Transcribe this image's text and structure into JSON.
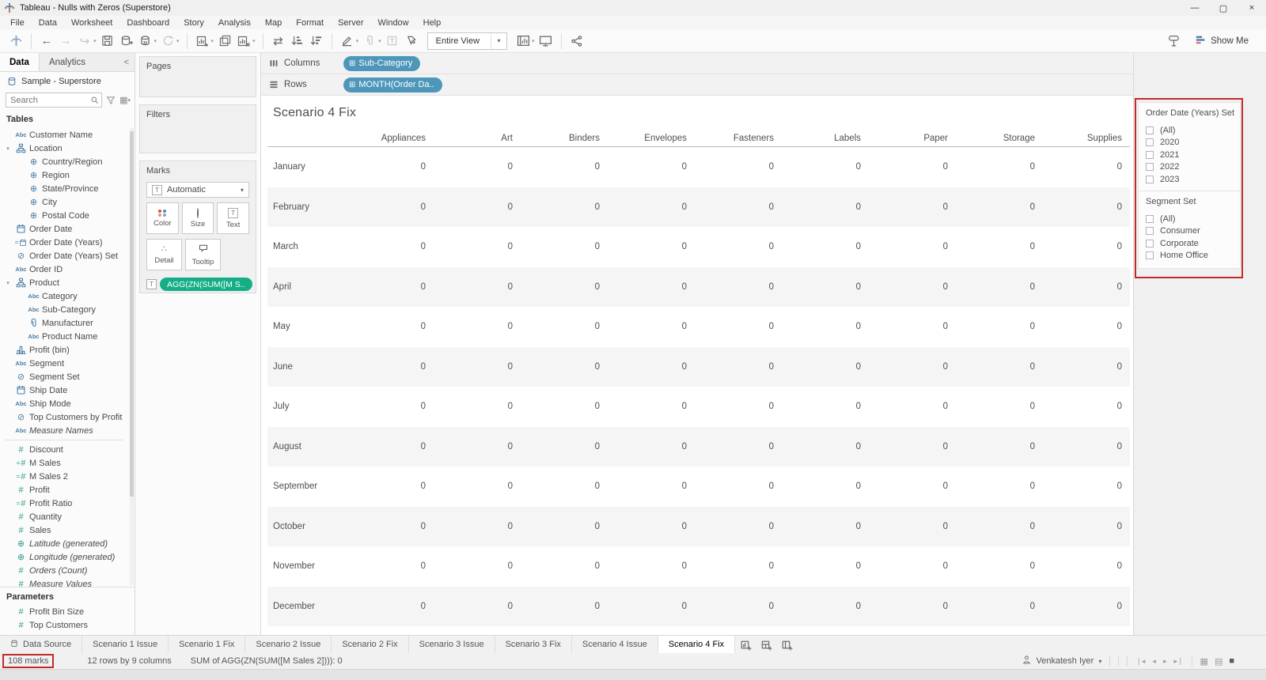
{
  "window": {
    "title": "Tableau - Nulls with Zeros (Superstore)",
    "menu": [
      "File",
      "Data",
      "Worksheet",
      "Dashboard",
      "Story",
      "Analysis",
      "Map",
      "Format",
      "Server",
      "Window",
      "Help"
    ],
    "controls": {
      "minimize": "—",
      "restore": "▢",
      "close": "×"
    }
  },
  "toolbar": {
    "view_mode": "Entire View",
    "show_me_label": "Show Me"
  },
  "sidebar": {
    "tabs": {
      "data": "Data",
      "analytics": "Analytics"
    },
    "datasource": "Sample - Superstore",
    "search_placeholder": "Search",
    "tables_label": "Tables",
    "fields": [
      {
        "icon": "abc",
        "label": "Customer Name",
        "indent": 1
      },
      {
        "icon": "hier",
        "label": "Location",
        "indent": 0,
        "caret": true
      },
      {
        "icon": "globe",
        "label": "Country/Region",
        "indent": 2
      },
      {
        "icon": "globe",
        "label": "Region",
        "indent": 2
      },
      {
        "icon": "globe",
        "label": "State/Province",
        "indent": 2
      },
      {
        "icon": "globe",
        "label": "City",
        "indent": 2
      },
      {
        "icon": "globe",
        "label": "Postal Code",
        "indent": 2
      },
      {
        "icon": "cal",
        "label": "Order Date",
        "indent": 1
      },
      {
        "icon": "cal-calc",
        "label": "Order Date (Years)",
        "indent": 1
      },
      {
        "icon": "set",
        "label": "Order Date (Years) Set",
        "indent": 1
      },
      {
        "icon": "abc",
        "label": "Order ID",
        "indent": 1
      },
      {
        "icon": "hier",
        "label": "Product",
        "indent": 0,
        "caret": true
      },
      {
        "icon": "abc",
        "label": "Category",
        "indent": 2
      },
      {
        "icon": "abc",
        "label": "Sub-Category",
        "indent": 2
      },
      {
        "icon": "clip",
        "label": "Manufacturer",
        "indent": 2
      },
      {
        "icon": "abc",
        "label": "Product Name",
        "indent": 2
      },
      {
        "icon": "bin",
        "label": "Profit (bin)",
        "indent": 1
      },
      {
        "icon": "abc",
        "label": "Segment",
        "indent": 1
      },
      {
        "icon": "set",
        "label": "Segment Set",
        "indent": 1
      },
      {
        "icon": "cal",
        "label": "Ship Date",
        "indent": 1
      },
      {
        "icon": "abc",
        "label": "Ship Mode",
        "indent": 1
      },
      {
        "icon": "set",
        "label": "Top Customers by Profit",
        "indent": 1
      },
      {
        "icon": "abc",
        "label": "Measure Names",
        "indent": 1,
        "italic": true
      },
      {
        "divider": true
      },
      {
        "icon": "hash",
        "label": "Discount",
        "indent": 1
      },
      {
        "icon": "hash-calc",
        "label": "M Sales",
        "indent": 1
      },
      {
        "icon": "hash-calc",
        "label": "M Sales 2",
        "indent": 1
      },
      {
        "icon": "hash",
        "label": "Profit",
        "indent": 1
      },
      {
        "icon": "hash-calc",
        "label": "Profit Ratio",
        "indent": 1
      },
      {
        "icon": "hash",
        "label": "Quantity",
        "indent": 1
      },
      {
        "icon": "hash",
        "label": "Sales",
        "indent": 1
      },
      {
        "icon": "globe-green",
        "label": "Latitude (generated)",
        "indent": 1,
        "italic": true
      },
      {
        "icon": "globe-green",
        "label": "Longitude (generated)",
        "indent": 1,
        "italic": true
      },
      {
        "icon": "hash",
        "label": "Orders (Count)",
        "indent": 1,
        "italic": true
      },
      {
        "icon": "hash",
        "label": "Measure Values",
        "indent": 1,
        "italic": true
      }
    ],
    "parameters_label": "Parameters",
    "parameters": [
      {
        "icon": "hash",
        "label": "Profit Bin Size"
      },
      {
        "icon": "hash",
        "label": "Top Customers"
      }
    ]
  },
  "cards": {
    "pages_label": "Pages",
    "filters_label": "Filters",
    "marks_label": "Marks",
    "marks_type": "Automatic",
    "marks_buttons": [
      "Color",
      "Size",
      "Text",
      "Detail",
      "Tooltip"
    ],
    "marks_pill": "AGG(ZN(SUM([M S.."
  },
  "shelves": {
    "columns_label": "Columns",
    "rows_label": "Rows",
    "columns_pill": "Sub-Category",
    "rows_pill": "MONTH(Order Da.."
  },
  "sheet": {
    "title": "Scenario 4 Fix",
    "columns": [
      "Appliances",
      "Art",
      "Binders",
      "Envelopes",
      "Fasteners",
      "Labels",
      "Paper",
      "Storage",
      "Supplies"
    ],
    "months": [
      "January",
      "February",
      "March",
      "April",
      "May",
      "June",
      "July",
      "August",
      "September",
      "October",
      "November",
      "December"
    ],
    "cell_value": "0"
  },
  "filter_panel": {
    "sets": [
      {
        "title": "Order Date (Years) Set",
        "options": [
          "(All)",
          "2020",
          "2021",
          "2022",
          "2023"
        ]
      },
      {
        "title": "Segment Set",
        "options": [
          "(All)",
          "Consumer",
          "Corporate",
          "Home Office"
        ]
      }
    ]
  },
  "tabs": {
    "datasource_label": "Data Source",
    "sheets": [
      "Scenario 1 Issue",
      "Scenario 1 Fix",
      "Scenario 2 Issue",
      "Scenario 2 Fix",
      "Scenario 3 Issue",
      "Scenario 3 Fix",
      "Scenario 4 Issue",
      "Scenario 4 Fix"
    ],
    "active": "Scenario 4 Fix"
  },
  "status_bar": {
    "marks": "108 marks",
    "dimensions": "12 rows by 9 columns",
    "aggregation": "SUM of AGG(ZN(SUM([M Sales 2]))): 0",
    "user": "Venkatesh Iyer"
  },
  "colors": {
    "dimension_pill": "#4e97ba",
    "measure_pill": "#16ae86",
    "dimension_icon": "#4a7da5",
    "measure_icon": "#2f9e8f",
    "annotation_red": "#c22a2a"
  }
}
